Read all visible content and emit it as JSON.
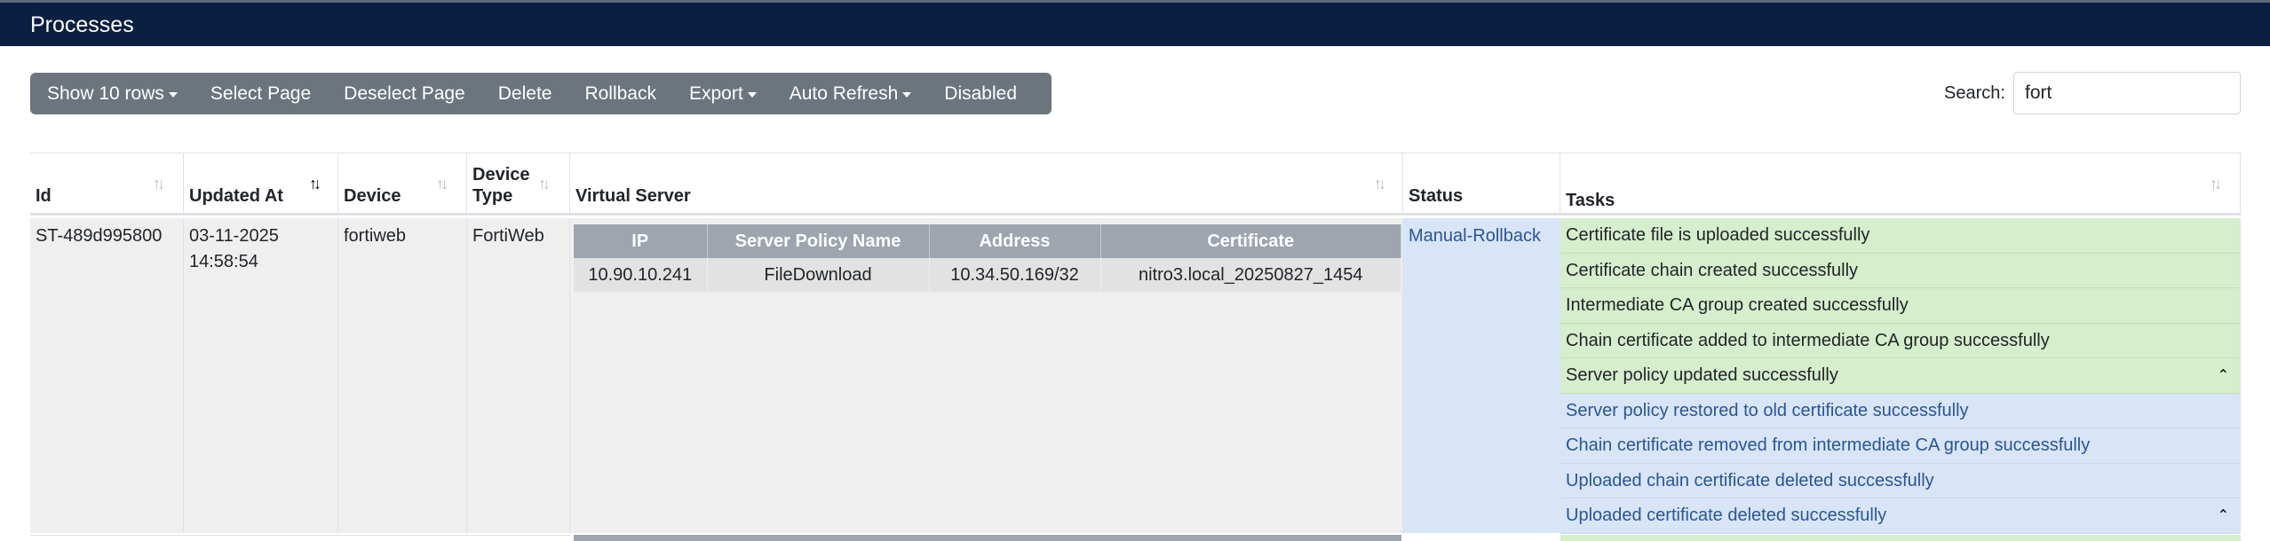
{
  "header": {
    "title": "Processes"
  },
  "toolbar": {
    "show_rows": "Show 10 rows",
    "select_page": "Select Page",
    "deselect_page": "Deselect Page",
    "delete": "Delete",
    "rollback": "Rollback",
    "export": "Export",
    "auto_refresh": "Auto Refresh",
    "disabled": "Disabled"
  },
  "search": {
    "label": "Search:",
    "value": "fort"
  },
  "table": {
    "columns": {
      "id": "Id",
      "updated_at": "Updated At",
      "device": "Device",
      "device_type_line1": "Device",
      "device_type_line2": "Type",
      "virtual_server": "Virtual Server",
      "status": "Status",
      "tasks": "Tasks"
    },
    "rows": [
      {
        "id": "ST-489d995800",
        "updated_date": "03-11-2025",
        "updated_time": "14:58:54",
        "device": "fortiweb",
        "device_type": "FortiWeb",
        "virtual_server": {
          "headers": [
            "IP",
            "Server Policy Name",
            "Address",
            "Certificate"
          ],
          "rows": [
            [
              "10.90.10.241",
              "FileDownload",
              "10.34.50.169/32",
              "nitro3.local_20250827_1454"
            ]
          ]
        },
        "status": "Manual-Rollback",
        "tasks": [
          "Certificate file is uploaded successfully",
          "Certificate chain created successfully",
          "Intermediate CA group created successfully",
          "Chain certificate added to intermediate CA group successfully",
          "Server policy updated successfully",
          "Server policy restored to old certificate successfully",
          "Chain certificate removed from intermediate CA group successfully",
          "Uploaded chain certificate deleted successfully",
          "Uploaded certificate deleted successfully"
        ]
      }
    ]
  },
  "colors": {
    "header_bg": "#0b2040",
    "toolbar_bg": "#6c757d",
    "success_row": "#d5eecb",
    "info_row": "#d8e5f6",
    "link": "#2a5599"
  },
  "icons": {
    "sort": "sort-icon",
    "sort_desc": "sort-desc-icon",
    "caret": "caret-down-icon",
    "collapse": "chevron-up-icon"
  }
}
